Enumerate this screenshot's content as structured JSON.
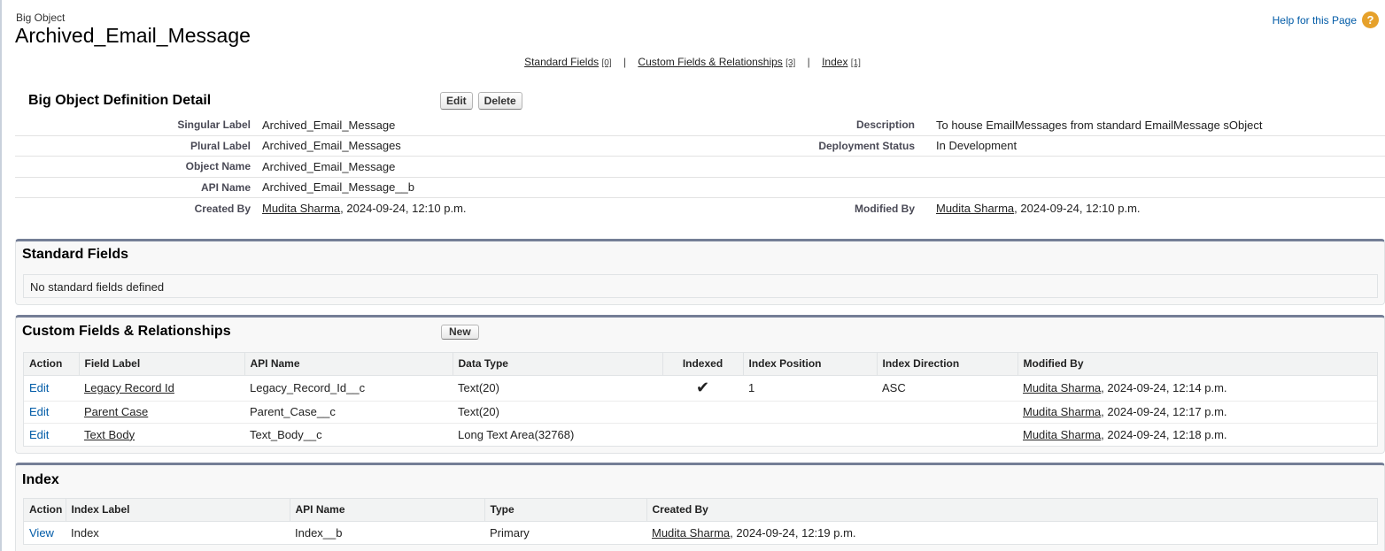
{
  "header": {
    "object_type": "Big Object",
    "title": "Archived_Email_Message",
    "help_text": "Help for this Page",
    "help_icon": "?"
  },
  "related_nav": [
    {
      "label": "Standard Fields",
      "count": "[0]"
    },
    {
      "label": "Custom Fields & Relationships",
      "count": "[3]"
    },
    {
      "label": "Index",
      "count": "[1]"
    }
  ],
  "related_nav_separator": "|",
  "detail": {
    "title": "Big Object Definition Detail",
    "edit_label": "Edit",
    "delete_label": "Delete",
    "singular_label": {
      "label": "Singular Label",
      "value": "Archived_Email_Message"
    },
    "plural_label": {
      "label": "Plural Label",
      "value": "Archived_Email_Messages"
    },
    "object_name": {
      "label": "Object Name",
      "value": "Archived_Email_Message"
    },
    "api_name": {
      "label": "API Name",
      "value": "Archived_Email_Message__b"
    },
    "created_by": {
      "label": "Created By",
      "user": "Mudita Sharma",
      "date": ", 2024-09-24, 12:10 p.m."
    },
    "description": {
      "label": "Description",
      "value": "To house EmailMessages from standard EmailMessage sObject"
    },
    "deployment_status": {
      "label": "Deployment Status",
      "value": "In Development"
    },
    "modified_by": {
      "label": "Modified By",
      "user": "Mudita Sharma",
      "date": ", 2024-09-24, 12:10 p.m."
    }
  },
  "standard_fields": {
    "title": "Standard Fields",
    "empty_text": "No standard fields defined"
  },
  "custom_fields": {
    "title": "Custom Fields & Relationships",
    "new_label": "New",
    "columns": [
      "Action",
      "Field Label",
      "API Name",
      "Data Type",
      "Indexed",
      "Index Position",
      "Index Direction",
      "Modified By"
    ],
    "rows": [
      {
        "action": "Edit",
        "label": "Legacy Record Id",
        "api": "Legacy_Record_Id__c",
        "type": "Text(20)",
        "indexed": "✔",
        "position": "1",
        "direction": "ASC",
        "user": "Mudita Sharma",
        "date": ", 2024-09-24, 12:14 p.m."
      },
      {
        "action": "Edit",
        "label": "Parent Case",
        "api": "Parent_Case__c",
        "type": "Text(20)",
        "indexed": "",
        "position": "",
        "direction": "",
        "user": "Mudita Sharma",
        "date": ", 2024-09-24, 12:17 p.m."
      },
      {
        "action": "Edit",
        "label": "Text Body",
        "api": "Text_Body__c",
        "type": "Long Text Area(32768)",
        "indexed": "",
        "position": "",
        "direction": "",
        "user": "Mudita Sharma",
        "date": ", 2024-09-24, 12:18 p.m."
      }
    ]
  },
  "index": {
    "title": "Index",
    "columns": [
      "Action",
      "Index Label",
      "API Name",
      "Type",
      "Created By"
    ],
    "rows": [
      {
        "action": "View",
        "label": "Index",
        "api": "Index__b",
        "type": "Primary",
        "user": "Mudita Sharma",
        "date": ", 2024-09-24, 12:19 p.m."
      }
    ]
  }
}
